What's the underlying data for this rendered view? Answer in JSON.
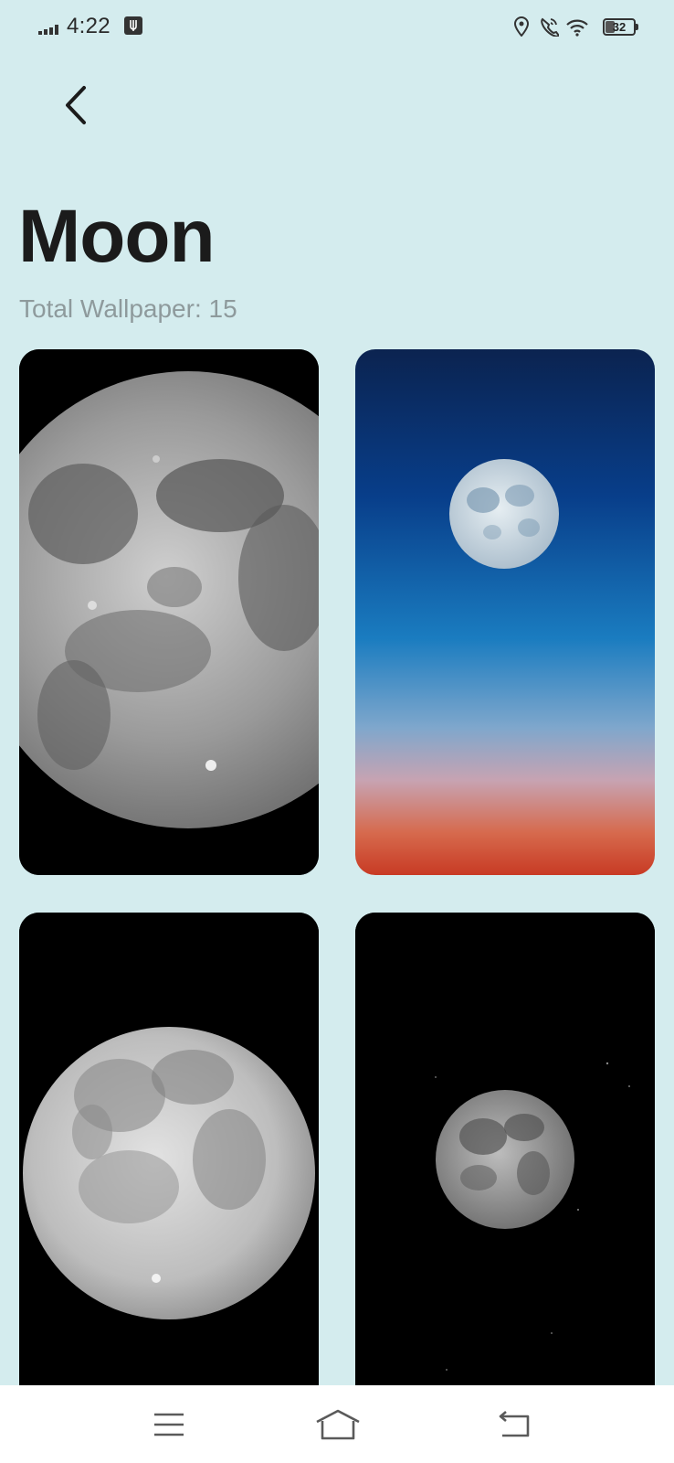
{
  "status_bar": {
    "time": "4:22",
    "battery_level": "32",
    "battery_fraction": 0.32,
    "icons": [
      "signal-icon",
      "usb-debug-icon",
      "location-icon",
      "wifi-calling-icon",
      "wifi-icon",
      "battery-icon"
    ]
  },
  "header": {
    "back_icon": "chevron-left-icon",
    "title": "Moon",
    "subtitle": "Total Wallpaper: 15"
  },
  "wallpapers": [
    {
      "subject": "moon-closeup-grayscale"
    },
    {
      "subject": "moon-over-gradient-sky"
    },
    {
      "subject": "full-moon-black-sky"
    },
    {
      "subject": "small-moon-starry-sky"
    }
  ],
  "nav_bar": {
    "icons": [
      "menu-icon",
      "home-icon",
      "back-icon"
    ]
  },
  "colors": {
    "background": "#d4ecee",
    "title": "#1b1b1b",
    "subtitle": "#8e9a9c",
    "nav_bar": "#ffffff"
  }
}
